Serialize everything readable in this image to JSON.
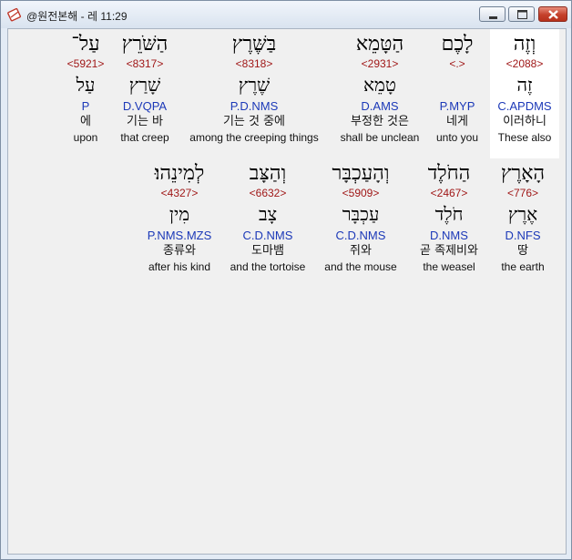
{
  "window": {
    "title": "@원전본해 - 레 11:29",
    "icon": "bible-app-icon"
  },
  "row1": [
    {
      "hebrew": "וְזֶה",
      "strong": "<2088>",
      "lemma": "זֶה",
      "morph": "C.APDMS",
      "korean": "이러하니",
      "english": "These also"
    },
    {
      "hebrew": "לָכֶם",
      "strong": "<.>",
      "lemma": "",
      "morph": "P.MYP",
      "korean": "네게",
      "english": "unto you"
    },
    {
      "hebrew": "הַטָּמֵא",
      "strong": "<2931>",
      "lemma": "טָמֵא",
      "morph": "D.AMS",
      "korean": "부정한 것은",
      "english": "shall be unclean"
    },
    {
      "hebrew": "בַּשֶּׁרֶץ",
      "strong": "<8318>",
      "lemma": "שֶׁרֶץ",
      "morph": "P.D.NMS",
      "korean": "기는 것 중에",
      "english": "among the creeping things"
    },
    {
      "hebrew": "הַשֹּׁרֵץ",
      "strong": "<8317>",
      "lemma": "שָׁרַץ",
      "morph": "D.VQPA",
      "korean": "기는 바",
      "english": "that creep"
    },
    {
      "hebrew": "עַל־",
      "strong": "<5921>",
      "lemma": "עַל",
      "morph": "P",
      "korean": "에",
      "english": "upon"
    }
  ],
  "row2": [
    {
      "hebrew": "הָאָרֶץ",
      "strong": "<776>",
      "lemma": "אֶרֶץ",
      "morph": "D.NFS",
      "korean": "땅",
      "english": "the earth"
    },
    {
      "hebrew": "הַחֹלֶד",
      "strong": "<2467>",
      "lemma": "חֹלֶד",
      "morph": "D.NMS",
      "korean": "곧 족제비와",
      "english": "the weasel"
    },
    {
      "hebrew": "וְהָעַכְבָּר",
      "strong": "<5909>",
      "lemma": "עַכְבָּר",
      "morph": "C.D.NMS",
      "korean": "쥐와",
      "english": "and the mouse"
    },
    {
      "hebrew": "וְהַצָּב",
      "strong": "<6632>",
      "lemma": "צָב",
      "morph": "C.D.NMS",
      "korean": "도마뱀",
      "english": "and the tortoise"
    },
    {
      "hebrew": "לְמִינֵהוּ׃",
      "strong": "<4327>",
      "lemma": "מִין",
      "morph": "P.NMS.MZS",
      "korean": "종류와",
      "english": "after his kind"
    }
  ]
}
